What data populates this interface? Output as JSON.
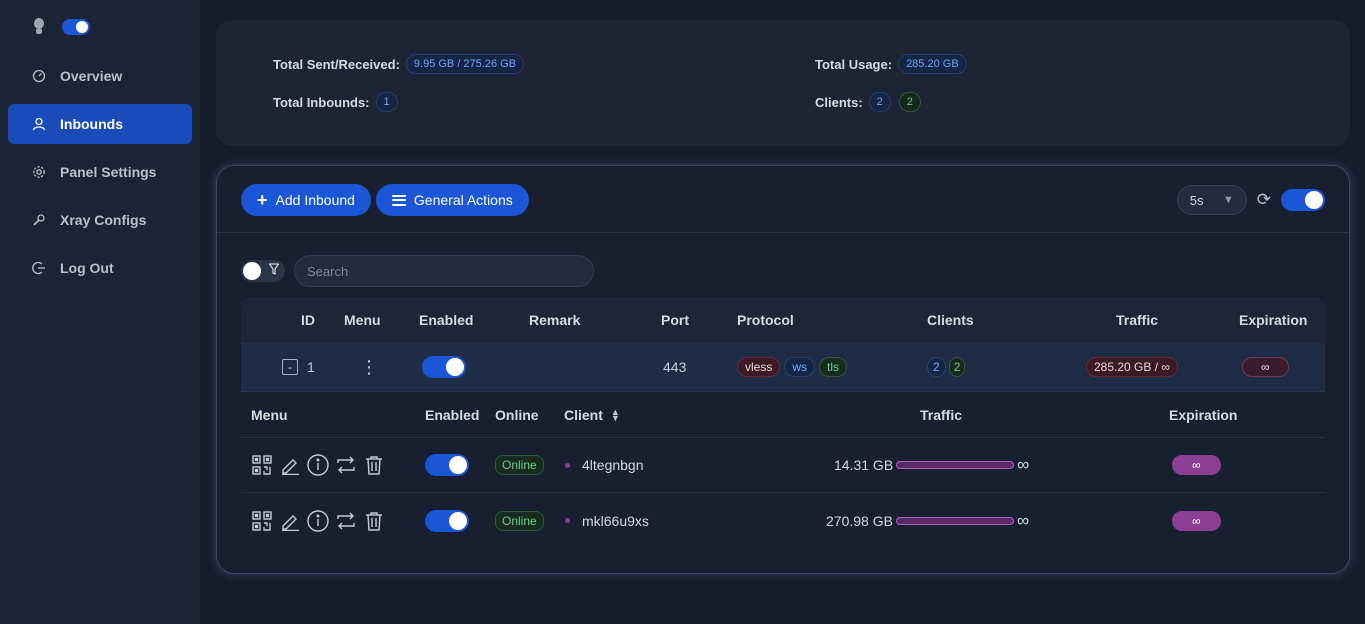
{
  "sidebar": {
    "theme_icon": "bulb-icon",
    "dark_mode_on": true,
    "items": [
      {
        "label": "Overview",
        "icon": "dashboard-icon"
      },
      {
        "label": "Inbounds",
        "icon": "user-icon",
        "active": true
      },
      {
        "label": "Panel Settings",
        "icon": "gear-icon"
      },
      {
        "label": "Xray Configs",
        "icon": "wrench-icon"
      },
      {
        "label": "Log Out",
        "icon": "logout-icon"
      }
    ]
  },
  "stats": {
    "sent_received_label": "Total Sent/Received:",
    "sent_received_value": "9.95 GB / 275.26 GB",
    "total_usage_label": "Total Usage:",
    "total_usage_value": "285.20 GB",
    "inbounds_label": "Total Inbounds:",
    "inbounds_value": "1",
    "clients_label": "Clients:",
    "clients_total": "2",
    "clients_online": "2"
  },
  "toolbar": {
    "add_inbound_label": "Add Inbound",
    "general_actions_label": "General Actions",
    "refresh_interval": "5s",
    "auto_refresh_on": true
  },
  "filter": {
    "search_placeholder": "Search"
  },
  "table": {
    "headers": [
      "ID",
      "Menu",
      "Enabled",
      "Remark",
      "Port",
      "Protocol",
      "Clients",
      "Traffic",
      "Expiration"
    ],
    "rows": [
      {
        "expand_symbol": "-",
        "id": "1",
        "enabled": true,
        "remark": "",
        "port": "443",
        "protocol_tags": [
          "vless",
          "ws",
          "tls"
        ],
        "clients_total": "2",
        "clients_online": "2",
        "traffic": "285.20 GB / ∞",
        "expiration": "∞"
      }
    ]
  },
  "clients_table": {
    "headers": {
      "menu": "Menu",
      "enabled": "Enabled",
      "online": "Online",
      "client": "Client",
      "traffic": "Traffic",
      "expiration": "Expiration"
    },
    "rows": [
      {
        "enabled": true,
        "status": "Online",
        "name": "4ltegnbgn",
        "traffic": "14.31 GB",
        "limit": "∞",
        "expiration": "∞"
      },
      {
        "enabled": true,
        "status": "Online",
        "name": "mkl66u9xs",
        "traffic": "270.98 GB",
        "limit": "∞",
        "expiration": "∞"
      }
    ]
  }
}
